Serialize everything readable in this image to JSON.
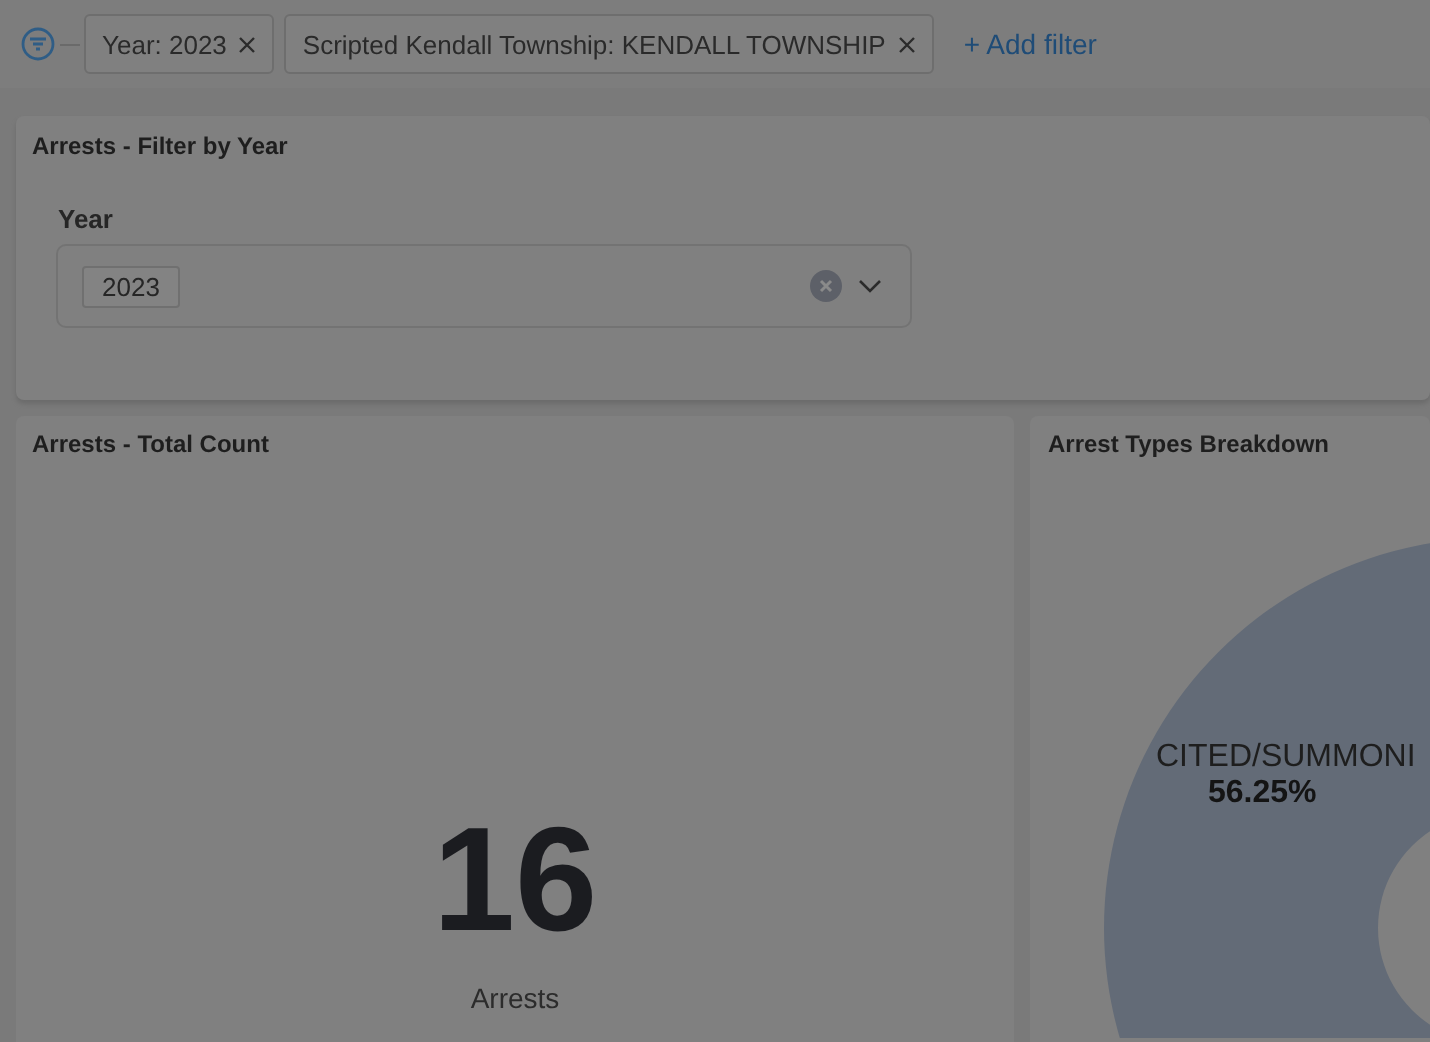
{
  "filter_bar": {
    "pills": [
      {
        "label": "Year: 2023"
      },
      {
        "label": "Scripted Kendall Township: KENDALL TOWNSHIP"
      }
    ],
    "add_filter": "+ Add filter"
  },
  "year_panel": {
    "title": "Arrests - Filter by Year",
    "field_label": "Year",
    "selected_values": [
      "2023"
    ]
  },
  "count_panel": {
    "title": "Arrests - Total Count",
    "value": "16",
    "caption": "Arrests"
  },
  "breakdown_panel": {
    "title": "Arrest Types Breakdown",
    "slice_label": "CITED/SUMMONI",
    "slice_percent": "56.25%"
  }
}
